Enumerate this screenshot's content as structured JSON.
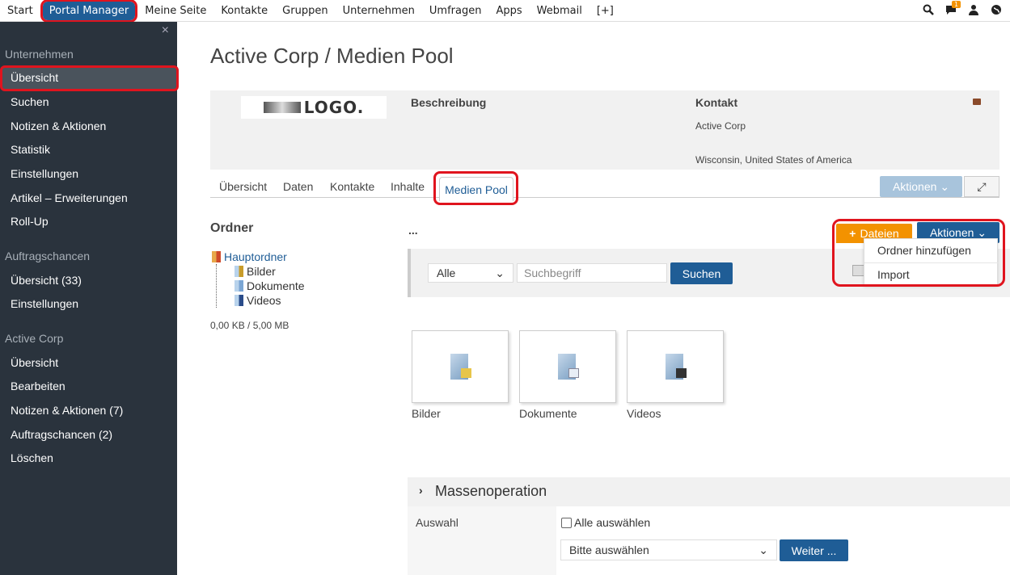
{
  "topnav": {
    "items": [
      "Start",
      "Portal Manager",
      "Meine Seite",
      "Kontakte",
      "Gruppen",
      "Unternehmen",
      "Umfragen",
      "Apps",
      "Webmail",
      "[+]"
    ],
    "notification_count": "1"
  },
  "sidebar": {
    "close": "×",
    "sections": [
      {
        "heading": "Unternehmen",
        "items": [
          "Übersicht",
          "Suchen",
          "Notizen & Aktionen",
          "Statistik",
          "Einstellungen",
          "Artikel – Erweiterungen",
          "Roll-Up"
        ]
      },
      {
        "heading": "Auftragschancen",
        "items": [
          "Übersicht (33)",
          "Einstellungen"
        ]
      },
      {
        "heading": "Active Corp",
        "items": [
          "Übersicht",
          "Bearbeiten",
          "Notizen & Aktionen (7)",
          "Auftragschancen (2)",
          "Löschen"
        ]
      }
    ]
  },
  "page": {
    "title": "Active Corp / Medien Pool",
    "logo_text": "LOGO.",
    "beschreibung_label": "Beschreibung",
    "kontakt_label": "Kontakt",
    "kontakt_name": "Active Corp",
    "kontakt_location": "Wisconsin, United States of America"
  },
  "tabs": [
    "Übersicht",
    "Daten",
    "Kontakte",
    "Inhalte",
    "Medien Pool"
  ],
  "toolbar": {
    "aktionen_disabled": "Aktionen",
    "dots": "...",
    "dateien": "Dateien",
    "aktionen": "Aktionen",
    "menu": [
      "Ordner hinzufügen",
      "Import"
    ]
  },
  "folders": {
    "heading": "Ordner",
    "root": "Hauptordner",
    "children": [
      "Bilder",
      "Dokumente",
      "Videos"
    ],
    "quota": "0,00 KB / 5,00 MB"
  },
  "search": {
    "filter_value": "Alle",
    "placeholder": "Suchbegriff",
    "button": "Suchen"
  },
  "cards": [
    "Bilder",
    "Dokumente",
    "Videos"
  ],
  "massenoperation": {
    "title": "Massenoperation",
    "auswahl_label": "Auswahl",
    "select_all": "Alle auswählen",
    "select_value": "Bitte auswählen",
    "weiter": "Weiter ..."
  },
  "colors": {
    "accent": "#1f5d96",
    "sidebar": "#2a333d",
    "orange": "#f39200",
    "highlight": "#e0141e"
  }
}
